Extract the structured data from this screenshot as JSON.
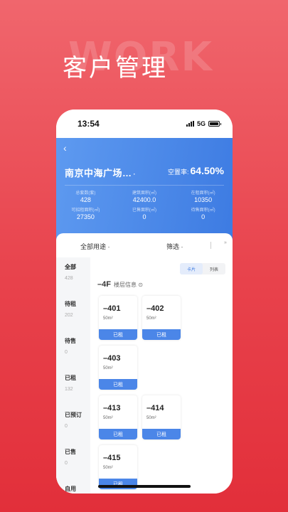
{
  "hero": {
    "watermark": "WORK",
    "title": "客户管理"
  },
  "status_bar": {
    "time": "13:54",
    "network": "5G"
  },
  "header": {
    "back_icon": "chevron-left-icon",
    "project_name": "南京中海广场…",
    "dropdown": "·",
    "vacancy_label": "空置率:",
    "vacancy_value": "64.50%"
  },
  "stats": [
    {
      "label": "总套数(套)",
      "value": "428"
    },
    {
      "label": "建筑面积(㎡)",
      "value": "42400.0"
    },
    {
      "label": "在租面积(㎡)",
      "value": "10350"
    },
    {
      "label": "可招租面积(㎡)",
      "value": "27350"
    },
    {
      "label": "已售面积(㎡)",
      "value": "0"
    },
    {
      "label": "待售面积(㎡)",
      "value": "0"
    }
  ],
  "filters": {
    "usage": "全部用途 ·",
    "screen": "筛选 ·",
    "more": "»"
  },
  "sidebar": [
    {
      "name": "全部",
      "count": "428"
    },
    {
      "name": "待租",
      "count": "202"
    },
    {
      "name": "待售",
      "count": "0"
    },
    {
      "name": "已租",
      "count": "132"
    },
    {
      "name": "已预订",
      "count": "0"
    },
    {
      "name": "已售",
      "count": "0"
    },
    {
      "name": "自用",
      "count": ""
    }
  ],
  "view_toggle": {
    "card": "卡片",
    "list": "列表"
  },
  "floor": {
    "name": "–4F",
    "info": "楼层信息 ⊙"
  },
  "units": [
    {
      "no": "–401",
      "area": "50m²",
      "status": "已租"
    },
    {
      "no": "–402",
      "area": "50m²",
      "status": "已租"
    },
    {
      "no": "–403",
      "area": "50m²",
      "status": "已租"
    },
    {
      "no": "–413",
      "area": "50m²",
      "status": "已租"
    },
    {
      "no": "–414",
      "area": "50m²",
      "status": "已租"
    },
    {
      "no": "–415",
      "area": "50m²",
      "status": "已租"
    }
  ]
}
